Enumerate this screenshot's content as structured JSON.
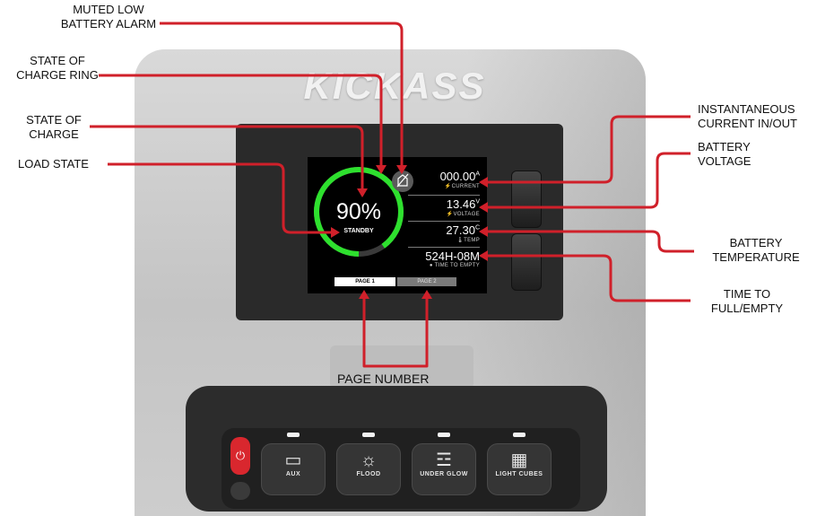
{
  "brand": {
    "logo_text": "KICKASS"
  },
  "screen": {
    "state_of_charge": "90%",
    "load_state": "STANDBY",
    "soc_fraction": 0.9,
    "readings": [
      {
        "value": "000.00",
        "unit": "A",
        "label": "CURRENT"
      },
      {
        "value": "13.46",
        "unit": "V",
        "label": "VOLTAGE"
      },
      {
        "value": "27.30",
        "unit": "C",
        "label": "TEMP"
      },
      {
        "value": "524H-08M",
        "unit": "",
        "label": "TIME TO EMPTY"
      }
    ],
    "pages": [
      "PAGE 1",
      "PAGE 2"
    ],
    "active_page": 0
  },
  "switches": [
    {
      "label": "AUX",
      "icon": "battery-icon"
    },
    {
      "label": "FLOOD",
      "icon": "flood-light-icon"
    },
    {
      "label": "UNDER GLOW",
      "icon": "under-glow-icon"
    },
    {
      "label": "LIGHT CUBES",
      "icon": "light-cubes-icon"
    }
  ],
  "annotations": {
    "muted_alarm": [
      "MUTED LOW",
      "BATTERY ALARM"
    ],
    "soc_ring": [
      "STATE OF",
      "CHARGE RING"
    ],
    "soc": [
      "STATE OF",
      "CHARGE"
    ],
    "load_state": [
      "LOAD STATE"
    ],
    "current": [
      "INSTANTANEOUS",
      "CURRENT IN/OUT"
    ],
    "voltage": [
      "BATTERY",
      "VOLTAGE"
    ],
    "temperature": [
      "BATTERY",
      "TEMPERATURE"
    ],
    "time": [
      "TIME TO",
      "FULL/EMPTY"
    ],
    "page_number": [
      "PAGE NUMBER"
    ]
  },
  "colors": {
    "annotation_line": "#d0202a",
    "ring": "#2ee02e",
    "power": "#d9272e"
  }
}
